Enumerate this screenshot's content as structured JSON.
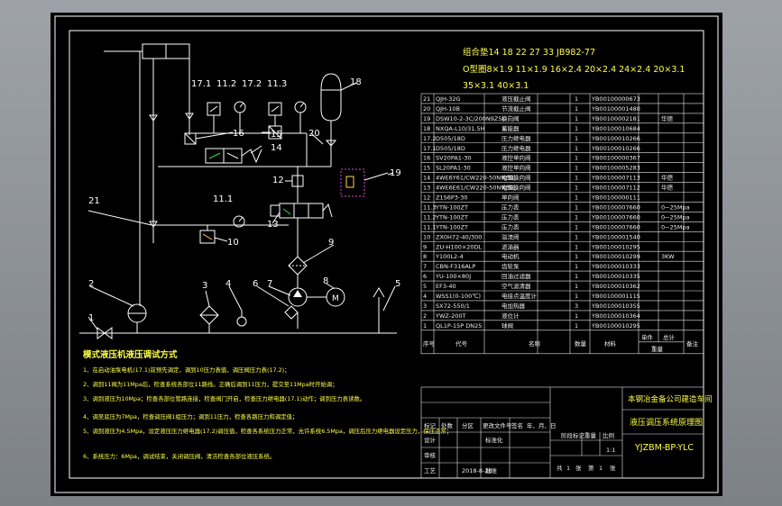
{
  "drawing": {
    "seal_header": "组合垫14 18 22 27 33 JB982-77",
    "oring_line1": "O型圈8×1.9  11×1.9  16×2.4  20×2.4  24×2.4  20×3.1",
    "oring_line2": "35×3.1  40×3.1",
    "callouts": [
      "1",
      "2",
      "3",
      "4",
      "5",
      "6",
      "7",
      "8",
      "9",
      "10",
      "11.1",
      "11.2",
      "11.3",
      "12",
      "13",
      "14",
      "15",
      "16",
      "17.1",
      "17.2",
      "18",
      "19",
      "20",
      "21"
    ],
    "notes_title": "模式液压机液压调试方式",
    "notes": [
      "1、在启动油泵电机(17.1)前预先调定，调到10压力表值，调压阀压力表(17.2)；",
      "2、调到11阀为11Mpa后，检查系统各部位11路线。正确后调到11压力，提交至11Mpa时开始调；",
      "3、调到液压为10Mpa；检查各部位管路连接，检查阀门开启，检查压力继电器(17.1)动作；调到压力表读数。",
      "4、调至底压为7Mpa，检查调压阀1组压力；调到11压力，检查各路压力和调定值；",
      "5、调到液压为4.5Mpa，设定液压压力继电器(17.2)调压值，检查各系统压力正常，允许系统6.5Mpa，调压后压力继电器设定压力，保压正常；",
      "6、系统压力：6Mpa，调试结束，关闭调压阀，清洁检查各部位液压系统。"
    ]
  },
  "bom": {
    "header": {
      "no": "序号",
      "code": "代号",
      "name": "名称",
      "qty": "数量",
      "material": "材料",
      "unit_weight": "单件",
      "total_weight": "总计",
      "weight": "重量",
      "remark": "备注"
    },
    "rows": [
      {
        "no": "21",
        "code": "QJH-32G",
        "name": "液压截止阀",
        "qty": "1",
        "mat": "YB00100000673",
        "rem": ""
      },
      {
        "no": "20",
        "code": "QJH-10B",
        "name": "节流截止阀",
        "qty": "1",
        "mat": "YB00100001480",
        "rem": ""
      },
      {
        "no": "19",
        "code": "DSW10-2-3C/200N9Z5L",
        "name": "换向阀",
        "qty": "1",
        "mat": "YB00100002181",
        "rem": "华德"
      },
      {
        "no": "18",
        "code": "NXQA-L10/31.5H",
        "name": "蓄能器",
        "qty": "1",
        "mat": "YB00100010684",
        "rem": ""
      },
      {
        "no": "17.2",
        "code": "D505/18D",
        "name": "压力继电器",
        "qty": "1",
        "mat": "YB00100010266",
        "rem": ""
      },
      {
        "no": "17.1",
        "code": "D505/18D",
        "name": "压力继电器",
        "qty": "1",
        "mat": "YB00100010266",
        "rem": ""
      },
      {
        "no": "16",
        "code": "SV20PA1-30",
        "name": "液控单向阀",
        "qty": "1",
        "mat": "YB00100000367",
        "rem": ""
      },
      {
        "no": "15",
        "code": "SL20PA1-30",
        "name": "液控单向阀",
        "qty": "1",
        "mat": "YB00100005283",
        "rem": ""
      },
      {
        "no": "14",
        "code": "4WE6Y61/CW220-50N9Z5L",
        "name": "电磁换向阀",
        "qty": "1",
        "mat": "YB00100007113",
        "rem": "华德"
      },
      {
        "no": "13",
        "code": "4WE6E61/CW220-50N9Z5L",
        "name": "电磁换向阀",
        "qty": "1",
        "mat": "YB00100007112",
        "rem": "华德"
      },
      {
        "no": "12",
        "code": "Z1S6P3-30",
        "name": "单向阀",
        "qty": "1",
        "mat": "YB00100000111",
        "rem": ""
      },
      {
        "no": "11.3",
        "code": "YTN-100ZT",
        "name": "压力表",
        "qty": "1",
        "mat": "YB00100007660",
        "rem": "0~25Mpa"
      },
      {
        "no": "11.2",
        "code": "YTN-100ZT",
        "name": "压力表",
        "qty": "1",
        "mat": "YB00100007660",
        "rem": "0~25Mpa"
      },
      {
        "no": "11.1",
        "code": "YTN-100ZT",
        "name": "压力表",
        "qty": "1",
        "mat": "YB00100007660",
        "rem": "0~25Mpa"
      },
      {
        "no": "10",
        "code": "ZX0H72-40/300",
        "name": "溢流阀",
        "qty": "1",
        "mat": "YB00100001540",
        "rem": ""
      },
      {
        "no": "9",
        "code": "ZU-H100×20DL",
        "name": "滤油器",
        "qty": "1",
        "mat": "YB00100010295",
        "rem": ""
      },
      {
        "no": "8",
        "code": "Y100L2-4",
        "name": "电动机",
        "qty": "1",
        "mat": "YB00100010299",
        "rem": "3KW"
      },
      {
        "no": "7",
        "code": "CBN-F316ALP",
        "name": "齿轮泵",
        "qty": "1",
        "mat": "YB00100010333",
        "rem": ""
      },
      {
        "no": "6",
        "code": "YU-100×80J",
        "name": "回油过滤器",
        "qty": "1",
        "mat": "YB00100010335",
        "rem": ""
      },
      {
        "no": "5",
        "code": "EF3-40",
        "name": "空气滤清器",
        "qty": "1",
        "mat": "YB00100010362",
        "rem": ""
      },
      {
        "no": "4",
        "code": "WSS1(0-100℃)",
        "name": "电接点温度计",
        "qty": "1",
        "mat": "YB00100001115",
        "rem": ""
      },
      {
        "no": "3",
        "code": "SX72-550/1",
        "name": "电加热器",
        "qty": "3",
        "mat": "YB00100010355",
        "rem": ""
      },
      {
        "no": "2",
        "code": "YWZ-200T",
        "name": "液位计",
        "qty": "1",
        "mat": "YB00100010364",
        "rem": ""
      },
      {
        "no": "1",
        "code": "QL1P-15P DN25",
        "name": "球阀",
        "qty": "1",
        "mat": "YB00100010295",
        "rem": ""
      }
    ]
  },
  "title_block": {
    "company": "本钢冶金备公司建造车间",
    "title": "液压调压系统原理图",
    "drawing_no": "YJZBM-BP-YLC",
    "labels": {
      "mark": "标记",
      "count": "处数",
      "zone": "分区",
      "doc": "更改文件号",
      "sign": "签名",
      "date": "年、月、日",
      "design": "设计",
      "standard": "标准化",
      "stage": "阶段标记",
      "weight": "重量",
      "scale": "比例",
      "review": "审核",
      "craft": "工艺",
      "approve": "批准",
      "sheet_total": "共",
      "sheet_no": "第",
      "sheet_unit": "张"
    },
    "design_date": "2018-8-28",
    "scale": "1:1",
    "sheet_total": "1",
    "sheet_no": "1"
  }
}
